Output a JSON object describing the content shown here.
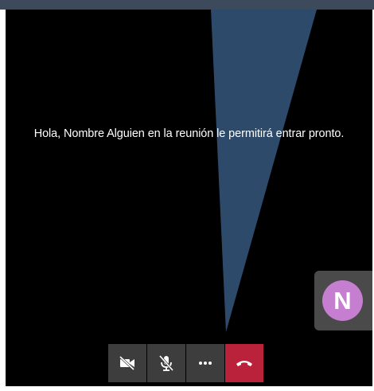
{
  "lobby": {
    "message": "Hola, Nombre Alguien en la reunión le permitirá entrar pronto."
  },
  "participant": {
    "initial": "N",
    "avatar_color": "#c67fd0"
  },
  "toolbar": {
    "buttons": [
      {
        "icon": "camera-off-icon"
      },
      {
        "icon": "microphone-off-icon"
      },
      {
        "icon": "more-options-icon"
      },
      {
        "icon": "hang-up-icon",
        "color": "#b9223a"
      }
    ]
  },
  "colors": {
    "stage_background": "#000000",
    "beam": "#2e4a6b",
    "toolbar_button": "#3d3d3d",
    "hangup_button": "#b9223a"
  }
}
